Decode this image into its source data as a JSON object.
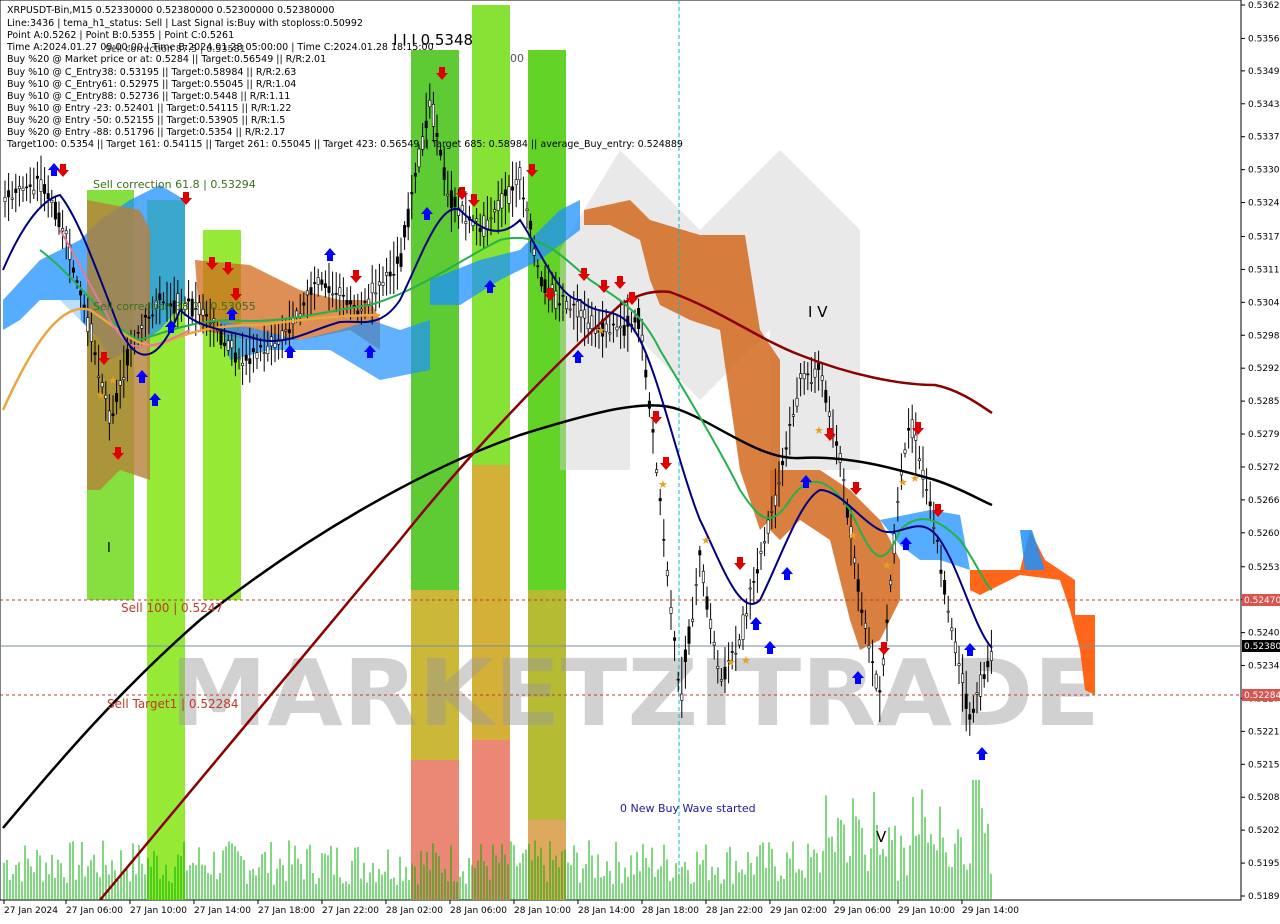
{
  "header": {
    "symbol_line": "XRPUSDT-Bin,M15  0.52330000 0.52380000 0.52300000 0.52380000",
    "line_status": "Line:3436 | tema_h1_status: Sell | Last Signal is:Buy with stoploss:0.50992",
    "points": "Point A:0.5262 | Point B:0.5355 | Point C:0.5261",
    "times": "Time A:2024.01.27 09:00:00 | Time B:2024.01.28 05:00:00 | Time C:2024.01.28 18:15:00",
    "buy_lines": [
      "Buy %20 @ Market price or at: 0.5284 || Target:0.56549 || R/R:2.01",
      "Buy %10 @ C_Entry38: 0.53195 || Target:0.58984 || R/R:2.63",
      "Buy %10 @ C_Entry61: 0.52975 || Target:0.55045 || R/R:1.04",
      "Buy %10 @ C_Entry88: 0.52736 || Target:0.5448 || R/R:1.11",
      "Buy %10 @ Entry -23: 0.52401 || Target:0.54115 || R/R:1.22",
      "Buy %20 @ Entry -50: 0.52155 || Target:0.53905 || R/R:1.5",
      "Buy %20 @ Entry -88: 0.51796 || Target:0.5354 || R/R:2.17"
    ],
    "targets": "Target100: 0.5354 || Target 161: 0.54115 || Target 261: 0.55045 || Target 423: 0.56549 || Target 685: 0.58984 || average_Buy_entry: 0.524889",
    "sell_correction_overlap": "Sell correction 87.5 | 0.53581"
  },
  "annotations": {
    "sell_corr_618": "Sell correction 61.8 | 0.53294",
    "sell_corr_382": "Sell correction 38.2 | 0.53055",
    "sell_100": "Sell 100 | 0.5247",
    "sell_target1": "Sell Target1 | 0.52284",
    "wave_high": "I I I 0.5348",
    "wave_iv": "I V",
    "wave_i": "I",
    "wave_v": "V",
    "new_buy_wave": "0 New Buy Wave started",
    "watermark": "MARKETZITRADE",
    "partial_00": "00"
  },
  "y_axis": {
    "labels": [
      "0.53627",
      "0.53562",
      "0.53499",
      "0.53435",
      "0.53371",
      "0.53307",
      "0.53243",
      "0.53177",
      "0.53113",
      "0.53049",
      "0.52985",
      "0.52921",
      "0.52857",
      "0.52793",
      "0.52729",
      "0.52665",
      "0.52601",
      "0.52535",
      "0.52471",
      "0.52407",
      "0.52343",
      "0.52279",
      "0.52215",
      "0.52151",
      "0.52087",
      "0.52023",
      "0.51959",
      "0.51895"
    ],
    "price_tags": [
      {
        "label": "0.52470",
        "color": "#d9534f"
      },
      {
        "label": "0.52380",
        "color": "#000000"
      },
      {
        "label": "0.52284",
        "color": "#d9534f"
      }
    ]
  },
  "x_axis": {
    "labels": [
      "27 Jan 2024",
      "27 Jan 06:00",
      "27 Jan 10:00",
      "27 Jan 14:00",
      "27 Jan 18:00",
      "27 Jan 22:00",
      "28 Jan 02:00",
      "28 Jan 06:00",
      "28 Jan 10:00",
      "28 Jan 14:00",
      "28 Jan 18:00",
      "28 Jan 22:00",
      "29 Jan 02:00",
      "29 Jan 06:00",
      "29 Jan 10:00",
      "29 Jan 14:00"
    ]
  },
  "chart_data": {
    "type": "line",
    "title": "XRPUSDT-Bin,M15",
    "x": [
      "27 Jan 2024",
      "27 Jan 06:00",
      "27 Jan 10:00",
      "27 Jan 14:00",
      "27 Jan 18:00",
      "27 Jan 22:00",
      "28 Jan 02:00",
      "28 Jan 06:00",
      "28 Jan 10:00",
      "28 Jan 14:00",
      "28 Jan 18:00",
      "28 Jan 22:00",
      "29 Jan 02:00",
      "29 Jan 06:00",
      "29 Jan 10:00",
      "29 Jan 14:00"
    ],
    "ylim": [
      0.51895,
      0.53627
    ],
    "series": [
      {
        "values": [
          0.5302,
          0.5318,
          0.5296,
          0.5294,
          0.5288,
          0.53,
          0.532,
          0.5322,
          0.5318,
          0.53,
          0.5272,
          0.5245,
          0.5265,
          0.525,
          0.525,
          0.5238
        ],
        "color": "#222222"
      },
      {
        "values": [
          0.5305,
          0.531,
          0.53,
          0.5298,
          0.529,
          0.5298,
          0.532,
          0.5318,
          0.531,
          0.5302,
          0.5278,
          0.525,
          0.5268,
          0.5255,
          0.5248,
          0.5237
        ],
        "color": "#000080"
      },
      {
        "values": [
          0.53,
          0.5305,
          0.5298,
          0.5296,
          0.5292,
          0.5296,
          0.5312,
          0.5315,
          0.5312,
          0.53,
          0.528,
          0.5262,
          0.5268,
          0.526,
          0.5255,
          0.5248
        ],
        "color": "#22b14c"
      },
      {
        "values": [
          0.5282,
          0.5296,
          0.5292,
          0.529,
          0.529,
          0.529,
          0.53,
          0.5305,
          0.5305,
          0.53,
          0.528,
          0.5262,
          0.5266,
          0.5259,
          0.5255,
          0.525
        ],
        "color": "#e8a640"
      },
      {
        "values": [
          0.521,
          0.5228,
          0.5236,
          0.5244,
          0.525,
          0.5254,
          0.5262,
          0.5272,
          0.5278,
          0.5284,
          0.5284,
          0.5277,
          0.5273,
          0.5272,
          0.527,
          0.5266
        ],
        "color": "#000000"
      },
      {
        "values": [
          0.517,
          0.518,
          0.5196,
          0.5214,
          0.5232,
          0.525,
          0.5266,
          0.5283,
          0.5294,
          0.5304,
          0.5304,
          0.5299,
          0.5294,
          0.529,
          0.5289,
          0.5284
        ],
        "color": "#8b0000"
      }
    ],
    "hlines": [
      {
        "y": 0.5247,
        "label": "Sell 100 | 0.5247",
        "color": "#c0392b",
        "style": "dashed"
      },
      {
        "y": 0.52284,
        "label": "Sell Target1 | 0.52284",
        "color": "#c0392b",
        "style": "dashed"
      },
      {
        "y": 0.5238,
        "color": "#444444",
        "style": "solid"
      }
    ],
    "grid": false
  },
  "colors": {
    "bg": "#ffffff",
    "green_band": "#5bd21b",
    "lime_band": "#9bff1b",
    "orange_cloud": "#d2691e",
    "blue_cloud": "#1e90ff",
    "up_arrow": "#0000ff",
    "down_arrow": "#e00000",
    "volume": "#00b000"
  }
}
